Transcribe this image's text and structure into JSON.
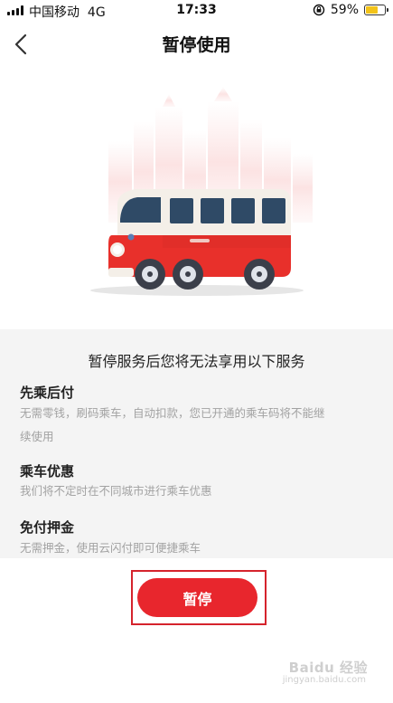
{
  "status_bar": {
    "carrier": "中国移动",
    "network": "4G",
    "time": "17:33",
    "battery_percent": "59%",
    "battery_level": 0.59,
    "battery_color": "#f3c319",
    "icons": [
      "signal-icon",
      "orientation-lock-icon",
      "battery-icon"
    ]
  },
  "nav": {
    "title": "暂停使用",
    "back_icon": "chevron-left-icon"
  },
  "hero": {
    "illustration": "red-and-white-bus-illustration",
    "colors": {
      "bus_red": "#e8302b",
      "bus_white": "#f4efe8",
      "window": "#2f4a66"
    }
  },
  "services": {
    "heading": "暂停服务后您将无法享用以下服务",
    "items": [
      {
        "name": "先乘后付",
        "desc_line1": "无需零钱，刷码乘车，自动扣款，您已开通的乘车码将不能继",
        "desc_line2": "续使用"
      },
      {
        "name": "乘车优惠",
        "desc_line1": "我们将不定时在不同城市进行乘车优惠"
      },
      {
        "name": "免付押金",
        "desc_line1": "无需押金，使用云闪付即可便捷乘车"
      }
    ]
  },
  "action": {
    "pause_label": "暂停",
    "button_color": "#e8262d"
  },
  "watermark": {
    "text": "Baidu 经验",
    "sub": "jingyan.baidu.com"
  }
}
